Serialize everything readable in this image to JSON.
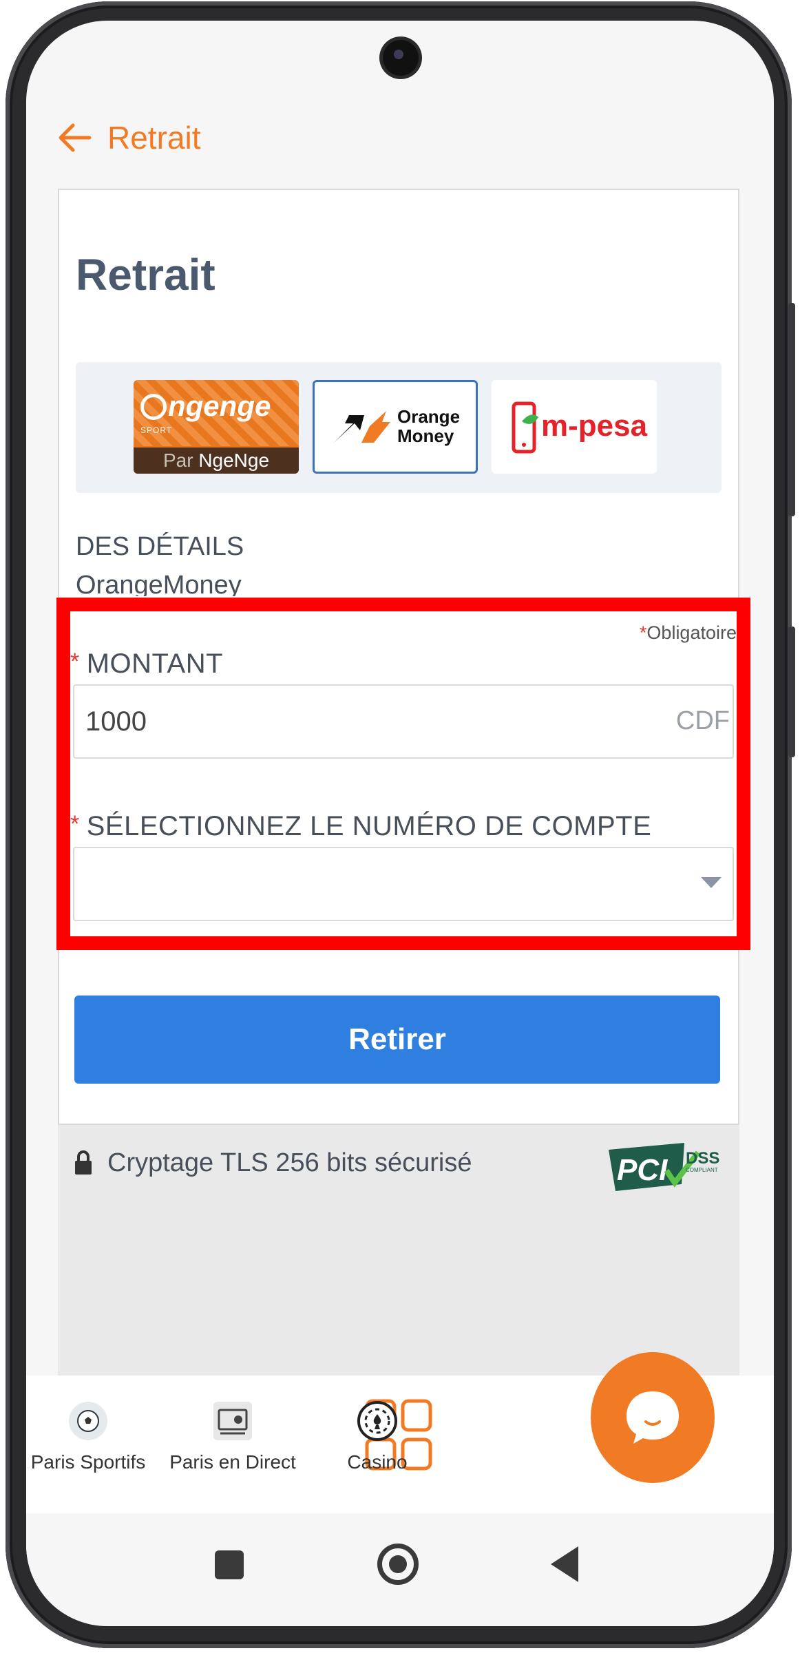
{
  "header": {
    "title": "Retrait"
  },
  "card": {
    "title": "Retrait"
  },
  "payment_methods": [
    {
      "name": "ngenge",
      "logo_text": "ngenge",
      "logo_sub": "SPORT",
      "caption_prefix": "Par",
      "caption_name": "NgeNge"
    },
    {
      "name": "orange-money",
      "logo_text": "Orange Money",
      "selected": true
    },
    {
      "name": "m-pesa",
      "logo_text": "m-pesa"
    }
  ],
  "details": {
    "heading": "DES DÉTAILS",
    "method": "OrangeMoney"
  },
  "form": {
    "required_note": "Obligatoire",
    "required_star": "*",
    "amount_label": "MONTANT",
    "amount_value": "1000",
    "currency": "CDF",
    "account_label": "SÉLECTIONNEZ LE NUMÉRO DE COMPTE",
    "account_value": ""
  },
  "submit_label": "Retirer",
  "security": {
    "text": "Cryptage TLS 256 bits sécurisé",
    "badge": "PCI DSS"
  },
  "bottom_nav": [
    {
      "label": "Paris Sportifs",
      "icon": "soccer-ball-icon"
    },
    {
      "label": "Paris en Direct",
      "icon": "live-tv-icon"
    },
    {
      "label": "",
      "icon": "grid-menu-icon"
    },
    {
      "label": "Casino",
      "icon": "casino-chip-icon"
    }
  ],
  "colors": {
    "accent": "#f07b24",
    "primary": "#2f7fe0",
    "highlight": "#ff0000",
    "text": "#474f5a"
  }
}
